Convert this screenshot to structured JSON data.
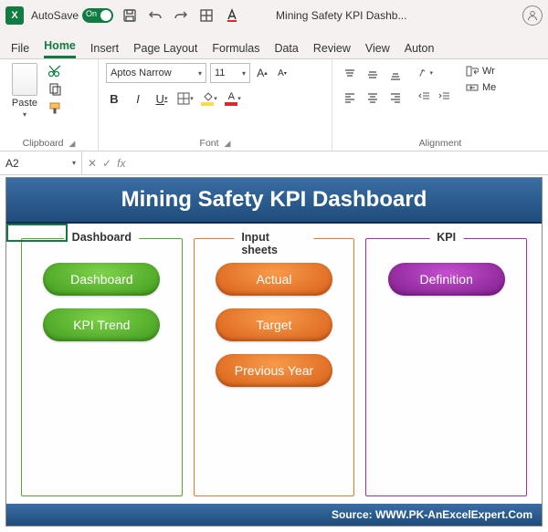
{
  "titlebar": {
    "autosave_label": "AutoSave",
    "autosave_state": "On",
    "doc_title": "Mining Safety KPI Dashb..."
  },
  "tabs": {
    "file": "File",
    "home": "Home",
    "insert": "Insert",
    "page_layout": "Page Layout",
    "formulas": "Formulas",
    "data": "Data",
    "review": "Review",
    "view": "View",
    "automate": "Auton"
  },
  "ribbon": {
    "clipboard": {
      "paste": "Paste",
      "label": "Clipboard"
    },
    "font": {
      "name": "Aptos Narrow",
      "size": "11",
      "label": "Font",
      "bold": "B",
      "italic": "I",
      "underline": "U"
    },
    "alignment": {
      "label": "Alignment",
      "wrap": "Wr",
      "merge": "Me"
    }
  },
  "formula_bar": {
    "cell_ref": "A2",
    "fx": "fx"
  },
  "dashboard": {
    "title": "Mining Safety KPI Dashboard",
    "panels": {
      "dashboard": {
        "title": "Dashboard",
        "btn1": "Dashboard",
        "btn2": "KPI Trend"
      },
      "input": {
        "title": "Input sheets",
        "btn1": "Actual",
        "btn2": "Target",
        "btn3": "Previous Year"
      },
      "kpi": {
        "title": "KPI",
        "btn1": "Definition"
      }
    },
    "footer": "Source: WWW.PK-AnExcelExpert.Com"
  }
}
